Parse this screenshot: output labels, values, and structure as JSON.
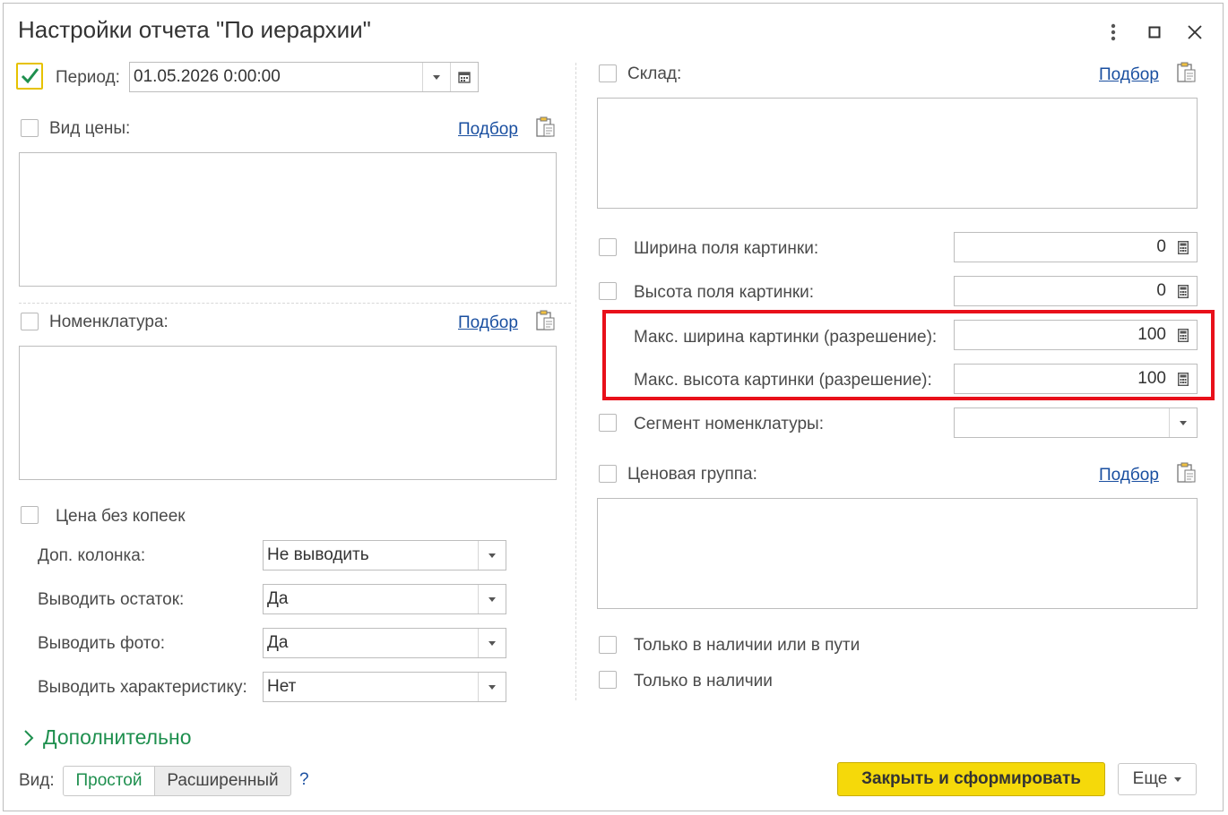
{
  "window": {
    "title": "Настройки отчета \"По иерархии\"",
    "more_icon": "vertical-dots-icon",
    "maximize_icon": "maximize-icon",
    "close_icon": "close-icon"
  },
  "left": {
    "period": {
      "label": "Период:",
      "value": "01.05.2026  0:00:00",
      "checked": true
    },
    "price_type": {
      "label": "Вид цены:",
      "pick_link": "Подбор",
      "checked": false
    },
    "nomenclature": {
      "label": "Номенклатура:",
      "pick_link": "Подбор",
      "checked": false
    },
    "no_kopecks": {
      "label": "Цена без копеек",
      "checked": false
    },
    "settings": [
      {
        "label": "Доп. колонка:",
        "value": "Не выводить"
      },
      {
        "label": "Выводить остаток:",
        "value": "Да"
      },
      {
        "label": "Выводить фото:",
        "value": "Да"
      },
      {
        "label": "Выводить характеристику:",
        "value": "Нет"
      }
    ]
  },
  "right": {
    "warehouse": {
      "label": "Склад:",
      "pick_link": "Подбор",
      "checked": false
    },
    "image_width": {
      "label": "Ширина поля картинки:",
      "value": "0",
      "checked": false
    },
    "image_height": {
      "label": "Высота поля картинки:",
      "value": "0",
      "checked": false
    },
    "max_width": {
      "label": "Макс. ширина картинки (разрешение):",
      "value": "100"
    },
    "max_height": {
      "label": "Макс. высота картинки (разрешение):",
      "value": "100"
    },
    "segment": {
      "label": "Сегмент номенклатуры:",
      "value": "",
      "checked": false
    },
    "price_group": {
      "label": "Ценовая группа:",
      "pick_link": "Подбор",
      "checked": false
    },
    "in_stock_or_transit": {
      "label": "Только в наличии или в пути",
      "checked": false
    },
    "in_stock": {
      "label": "Только в наличии",
      "checked": false
    }
  },
  "extra": {
    "label": "Дополнительно"
  },
  "footer": {
    "view_label": "Вид:",
    "view_simple": "Простой",
    "view_extended": "Расширенный",
    "help": "?",
    "submit": "Закрыть и сформировать",
    "more": "Еще"
  },
  "colors": {
    "accent_yellow": "#f5d90a",
    "highlight_red": "#e8101a",
    "link_blue": "#1a4fa0",
    "green": "#1e8f4e"
  }
}
